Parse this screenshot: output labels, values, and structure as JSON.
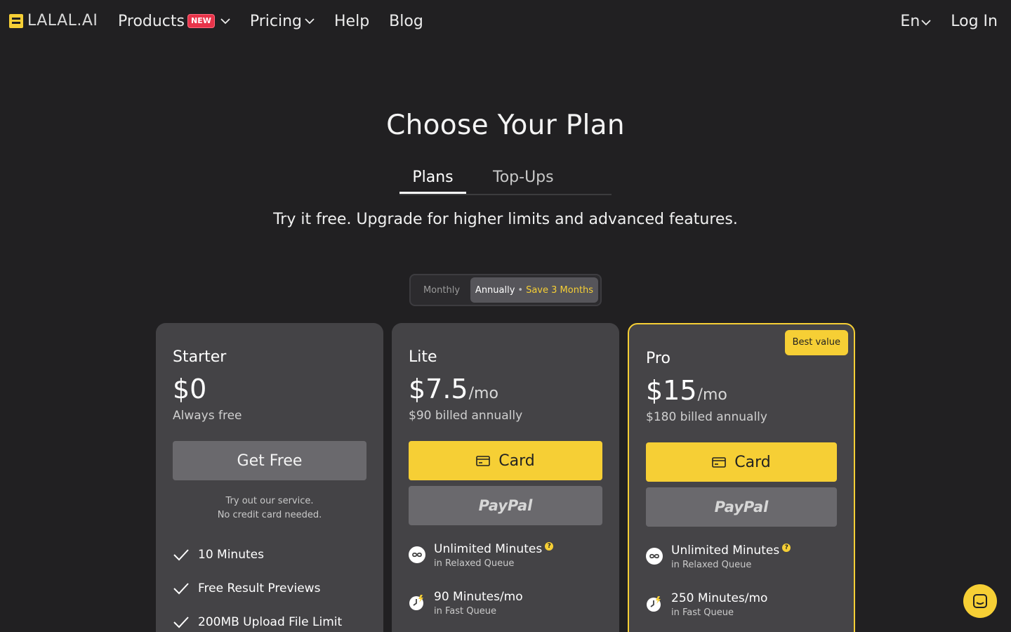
{
  "header": {
    "logo_text": "LALAL.AI",
    "nav": [
      {
        "label": "Products",
        "badge": "NEW"
      },
      {
        "label": "Pricing"
      },
      {
        "label": "Help"
      },
      {
        "label": "Blog"
      }
    ],
    "lang": "En",
    "login": "Log In"
  },
  "hero": {
    "title": "Choose Your Plan",
    "tabs": [
      "Plans",
      "Top-Ups"
    ],
    "subtitle": "Try it free. Upgrade for higher limits and advanced features."
  },
  "billing": {
    "monthly": "Monthly",
    "annually": "Annually",
    "separator": "•",
    "save": "Save 3 Months"
  },
  "plans": {
    "starter": {
      "name": "Starter",
      "price": "$0",
      "billed": "Always free",
      "cta": "Get Free",
      "note_line1": "Try out our service.",
      "note_line2": "No credit card needed.",
      "features": [
        "10 Minutes",
        "Free Result Previews",
        "200MB Upload File Limit"
      ]
    },
    "lite": {
      "name": "Lite",
      "price": "$7.5",
      "per": "/mo",
      "billed": "$90 billed annually",
      "card_label": "Card",
      "paypal_label": "PayPal",
      "features": [
        {
          "title": "Unlimited Minutes",
          "sub": "in Relaxed Queue",
          "icon": "infinity-icon"
        },
        {
          "title": "90 Minutes/mo",
          "sub": "in Fast Queue",
          "icon": "fast-clock-icon"
        }
      ]
    },
    "pro": {
      "name": "Pro",
      "badge": "Best value",
      "price": "$15",
      "per": "/mo",
      "billed": "$180 billed annually",
      "card_label": "Card",
      "paypal_label": "PayPal",
      "features": [
        {
          "title": "Unlimited Minutes",
          "sub": "in Relaxed Queue",
          "icon": "infinity-icon"
        },
        {
          "title": "250 Minutes/mo",
          "sub": "in Fast Queue",
          "icon": "fast-clock-icon"
        }
      ]
    }
  },
  "colors": {
    "background": "#212022",
    "accent": "#f6cf35",
    "card": "#444346",
    "badge_new": "#e8344a"
  }
}
